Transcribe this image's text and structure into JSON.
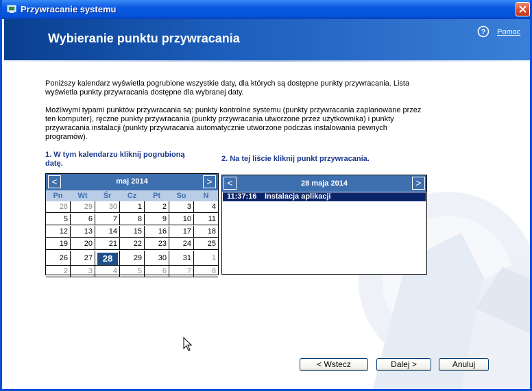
{
  "window": {
    "title": "Przywracanie systemu"
  },
  "header": {
    "title": "Wybieranie punktu przywracania",
    "help_label": "Pomoc"
  },
  "intro": {
    "p1_line1": "Poniższy kalendarz wyświetla pogrubione wszystkie daty, dla których są dostępne punkty przywracania. Lista",
    "p1_line2": "wyświetla punkty przywracania dostępne dla wybranej daty.",
    "p2_line1": "Możliwymi typami punktów przywracania są: punkty kontrolne systemu (punkty przywracania zaplanowane przez",
    "p2_line2": "ten komputer), ręczne punkty przywracania (punkty przywracania utworzone przez użytkownika) i punkty",
    "p2_line3": "przywracania instalacji (punkty przywracania automatycznie utworzone podczas instalowania pewnych",
    "p2_line4": "programów)."
  },
  "step1": {
    "line1": "1. W tym kalendarzu kliknij pogrubioną",
    "line2": "datę."
  },
  "step2": {
    "label": "2. Na tej liście kliknij punkt przywracania."
  },
  "calendar": {
    "month_label": "maj 2014",
    "prev": "<",
    "next": ">",
    "weekdays": [
      "Pn",
      "Wt",
      "Śr",
      "Cz",
      "Pt",
      "So",
      "N"
    ],
    "weeks": [
      [
        [
          "28",
          1
        ],
        [
          "29",
          1
        ],
        [
          "30",
          1
        ],
        [
          "1",
          0
        ],
        [
          "2",
          0
        ],
        [
          "3",
          0
        ],
        [
          "4",
          0
        ]
      ],
      [
        [
          "5",
          0
        ],
        [
          "6",
          0
        ],
        [
          "7",
          0
        ],
        [
          "8",
          0
        ],
        [
          "9",
          0
        ],
        [
          "10",
          0
        ],
        [
          "11",
          0
        ]
      ],
      [
        [
          "12",
          0
        ],
        [
          "13",
          0
        ],
        [
          "14",
          0
        ],
        [
          "15",
          0
        ],
        [
          "16",
          0
        ],
        [
          "17",
          0
        ],
        [
          "18",
          0
        ]
      ],
      [
        [
          "19",
          0
        ],
        [
          "20",
          0
        ],
        [
          "21",
          0
        ],
        [
          "22",
          0
        ],
        [
          "23",
          0
        ],
        [
          "24",
          0
        ],
        [
          "25",
          0
        ]
      ],
      [
        [
          "26",
          0
        ],
        [
          "27",
          0
        ],
        [
          "28",
          2
        ],
        [
          "29",
          0
        ],
        [
          "30",
          0
        ],
        [
          "31",
          0
        ],
        [
          "1",
          1
        ]
      ],
      [
        [
          "2",
          1
        ],
        [
          "3",
          1
        ],
        [
          "4",
          1
        ],
        [
          "5",
          1
        ],
        [
          "6",
          1
        ],
        [
          "7",
          1
        ],
        [
          "8",
          1
        ]
      ]
    ]
  },
  "restore_list": {
    "date_label": "28 maja 2014",
    "prev": "<",
    "next": ">",
    "items": [
      {
        "time": "11:37:16",
        "description": "Instalacja aplikacji"
      }
    ]
  },
  "buttons": {
    "back": "< Wstecz",
    "next": "Dalej >",
    "cancel": "Anuluj"
  },
  "colors": {
    "titlebar": "#0A58E0",
    "header": "#1B5DBA",
    "calendar_header": "#3E6FAE",
    "selection": "#0A246A"
  }
}
